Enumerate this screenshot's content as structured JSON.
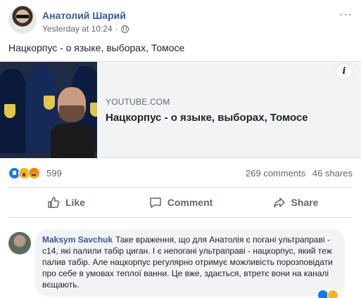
{
  "post": {
    "author": "Анатолий Шарий",
    "timestamp": "Yesterday at 10:24",
    "separator": "·",
    "text": "Нацкорпус - о языке, выборах, Томосе",
    "more": "···"
  },
  "link_card": {
    "domain": "YOUTUBE.COM",
    "title": "Нацкорпус - о языке, выборах, Томосе",
    "info": "i"
  },
  "stats": {
    "reaction_count": "599",
    "comments": "269 comments",
    "shares": "46 shares",
    "reactions": [
      "like-icon",
      "wow-icon",
      "angry-icon"
    ]
  },
  "actions": {
    "like": "Like",
    "comment": "Comment",
    "share": "Share"
  },
  "comment": {
    "author": "Maksym Savchuk",
    "text": "Таке враження, що для Анатолія є погані ультраправі - с14, які палили табір циган. І є непогані ультраправі - нацкорпус, який теж палив табір. Але нацкорпус регулярно отримує можливість порозповідати про себе в умовах теплої ванни. Це вже, здається, втретє вони на каналі вєщають."
  },
  "colors": {
    "link_blue": "#385898",
    "like_blue": "#1877f2",
    "muted": "#606770"
  }
}
